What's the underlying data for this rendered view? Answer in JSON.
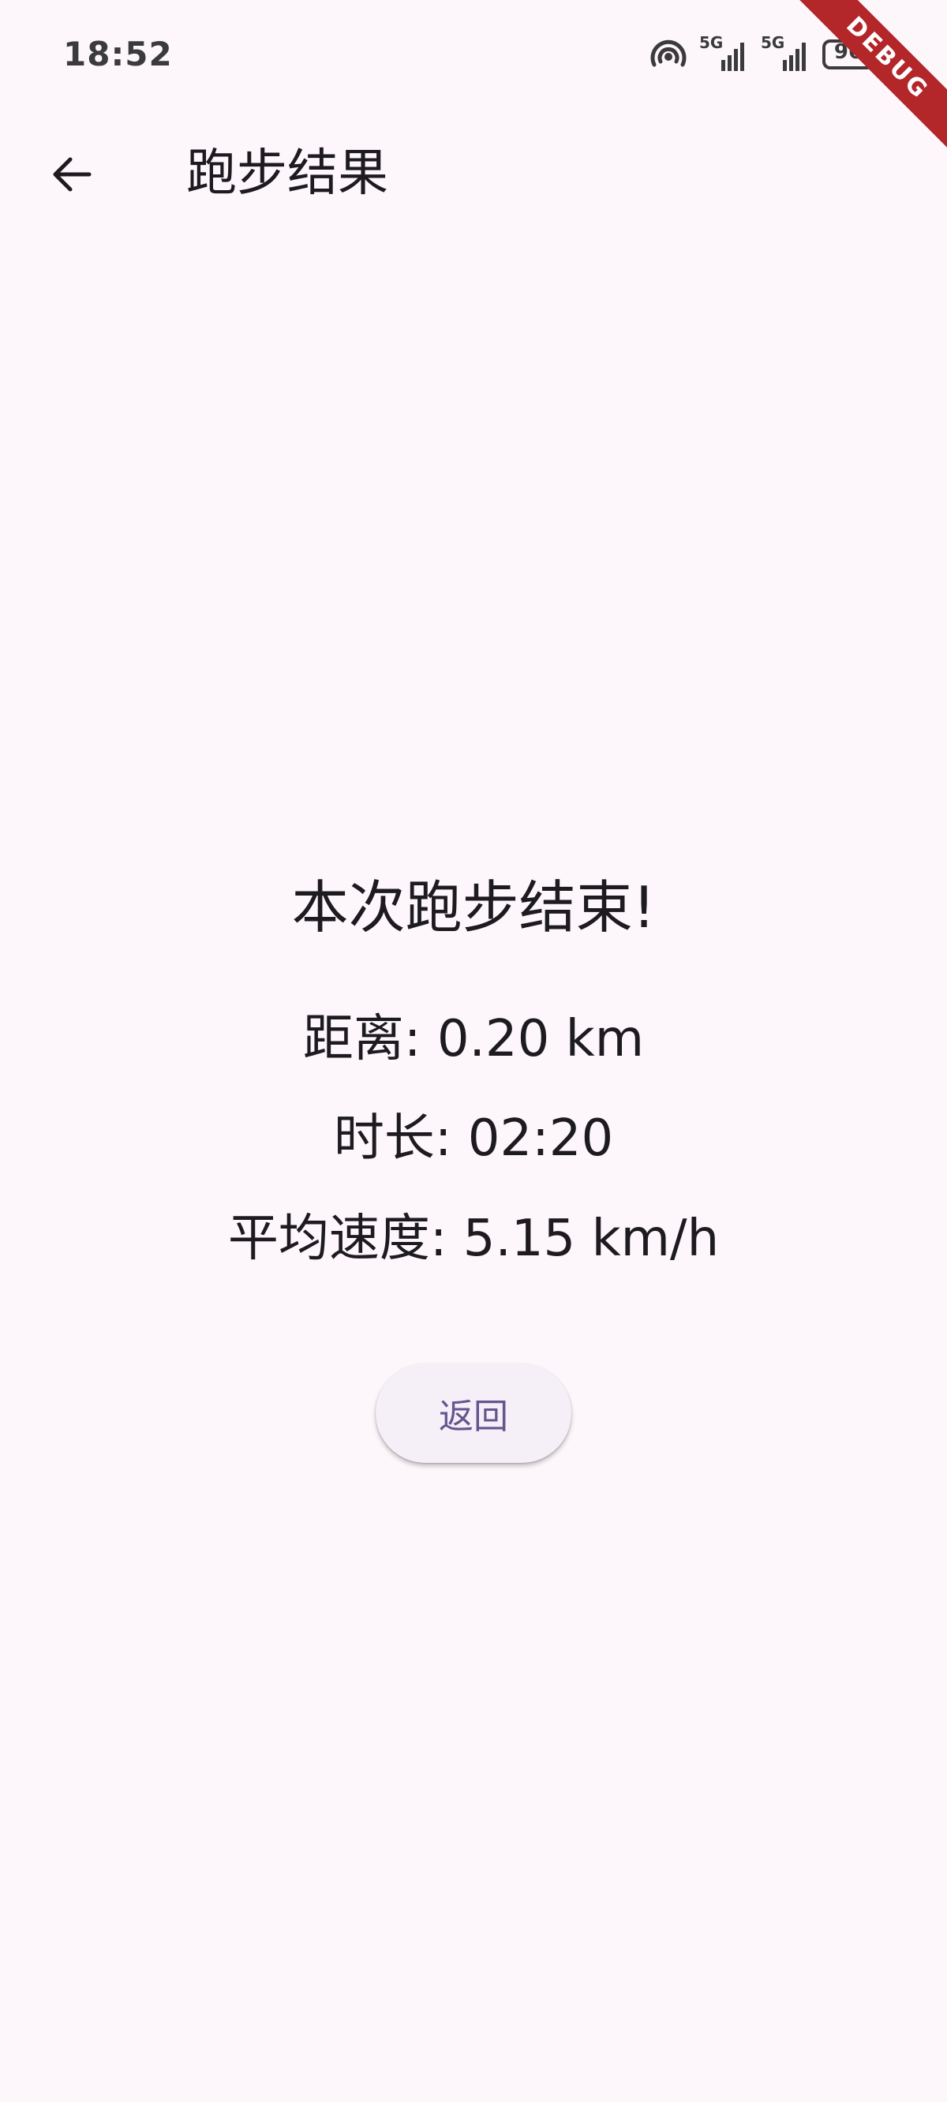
{
  "status_bar": {
    "time": "18:52",
    "network_1": "5G",
    "network_2": "5G",
    "battery": "96",
    "icons": [
      "hotspot-icon",
      "signal-5g-icon",
      "signal-5g-icon",
      "battery-icon"
    ]
  },
  "debug_banner": {
    "label": "DEBUG",
    "color": "#b3262a"
  },
  "app_bar": {
    "back_icon": "arrow-back-icon",
    "title": "跑步结果"
  },
  "result": {
    "heading": "本次跑步结束!",
    "distance": "距离: 0.20 km",
    "duration": "时长: 02:20",
    "avg_speed": "平均速度: 5.15 km/h"
  },
  "actions": {
    "return_label": "返回"
  },
  "colors": {
    "background": "#fdf7fc",
    "primary": "#65558f",
    "button_surface": "#f5eff7"
  }
}
